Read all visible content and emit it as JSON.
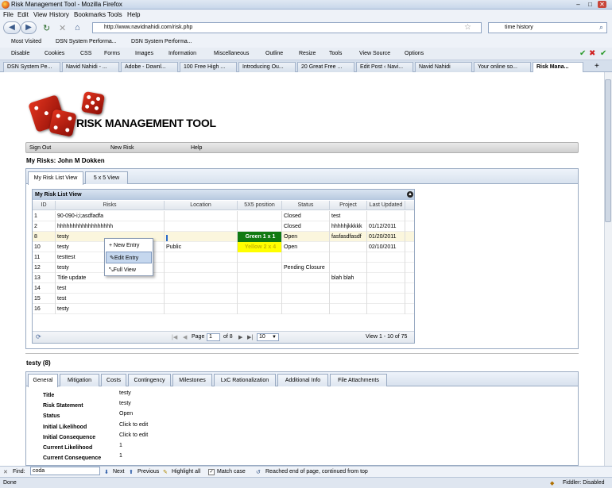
{
  "window": {
    "title": "Risk Management Tool - Mozilla Firefox"
  },
  "menu": [
    "File",
    "Edit",
    "View",
    "History",
    "Bookmarks",
    "Tools",
    "Help"
  ],
  "nav": {
    "url": "http://www.navidnahidi.com/risk.php",
    "search": "time history"
  },
  "bookmarks": [
    "Most Visited",
    "DSN System Performa...",
    "DSN System Performa..."
  ],
  "devbar": [
    "Disable",
    "Cookies",
    "CSS",
    "Forms",
    "Images",
    "Information",
    "Miscellaneous",
    "Outline",
    "Resize",
    "Tools",
    "View Source",
    "Options"
  ],
  "tabs": [
    "DSN System Pe...",
    "Navid Nahidi - ...",
    "Adobe - Downl...",
    "100 Free High ...",
    "Introducing Ou...",
    "20 Great Free ...",
    "Edit Post ‹ Navi...",
    "Navid Nahidi",
    "Your online so...",
    "Risk Mana..."
  ],
  "app": {
    "logo": "RISK MANAGEMENT TOOL",
    "nav": [
      "Sign Out",
      "New Risk",
      "Help"
    ],
    "my_risks": "My Risks: John M Dokken",
    "view_tabs": [
      "My Risk List View",
      "5 x 5 View"
    ],
    "grid": {
      "title": "My Risk List View",
      "columns": [
        "ID",
        "Risks",
        "Location",
        "5X5 position",
        "Status",
        "Project",
        "Last Updated"
      ],
      "rows": [
        {
          "id": "1",
          "risk": "90-090-i;i;asdfadfa",
          "location": "",
          "pos": "",
          "status": "Closed",
          "project": "test",
          "updated": ""
        },
        {
          "id": "2",
          "risk": "hhhhhhhhhhhhhhhhhh",
          "location": "",
          "pos": "",
          "status": "Closed",
          "project": "hhhhhjkkkkk",
          "updated": "01/12/2011"
        },
        {
          "id": "8",
          "risk": "testy",
          "location": "",
          "pos": "Green 1 x 1",
          "status": "Open",
          "project": "fasfasdfasdf",
          "updated": "01/20/2011"
        },
        {
          "id": "10",
          "risk": "testy",
          "location": "Public",
          "pos": "Yellow 2 x 4",
          "status": "Open",
          "project": "",
          "updated": "02/10/2011"
        },
        {
          "id": "11",
          "risk": "testtest",
          "location": "",
          "pos": "",
          "status": "",
          "project": "",
          "updated": ""
        },
        {
          "id": "12",
          "risk": "testy",
          "location": "",
          "pos": "",
          "status": "Pending Closure",
          "project": "",
          "updated": ""
        },
        {
          "id": "13",
          "risk": "Title update",
          "location": "",
          "pos": "",
          "status": "",
          "project": "blah blah",
          "updated": ""
        },
        {
          "id": "14",
          "risk": "test",
          "location": "",
          "pos": "",
          "status": "",
          "project": "",
          "updated": ""
        },
        {
          "id": "15",
          "risk": "test",
          "location": "",
          "pos": "",
          "status": "",
          "project": "",
          "updated": ""
        },
        {
          "id": "16",
          "risk": "testy",
          "location": "",
          "pos": "",
          "status": "",
          "project": "",
          "updated": ""
        }
      ],
      "pager": {
        "page_label": "Page",
        "page": "1",
        "of": "of 8",
        "per_page": "10",
        "summary": "View 1 - 10 of 75"
      }
    },
    "context_menu": [
      "New Entry",
      "Edit Entry",
      "Full View"
    ],
    "detail": {
      "title": "testy (8)",
      "tabs": [
        "General",
        "Mitigation",
        "Costs",
        "Contingency",
        "Milestones",
        "LxC Rationalization",
        "Additional Info",
        "File Attachments"
      ],
      "fields": [
        {
          "label": "Title",
          "value": "testy"
        },
        {
          "label": "Risk Statement",
          "value": "testy"
        },
        {
          "label": "Status",
          "value": "Open"
        },
        {
          "label": "Initial Likelihood",
          "value": "Click to edit"
        },
        {
          "label": "Initial Consequence",
          "value": "Click to edit"
        },
        {
          "label": "Current Likelihood",
          "value": "1"
        },
        {
          "label": "Current Consequence",
          "value": "1"
        }
      ]
    }
  },
  "find": {
    "label": "Find:",
    "query": "coda",
    "next": "Next",
    "previous": "Previous",
    "highlight": "Highlight all",
    "match": "Match case",
    "message": "Reached end of page, continued from top"
  },
  "status": {
    "left": "Done",
    "right": "Fiddler: Disabled"
  }
}
